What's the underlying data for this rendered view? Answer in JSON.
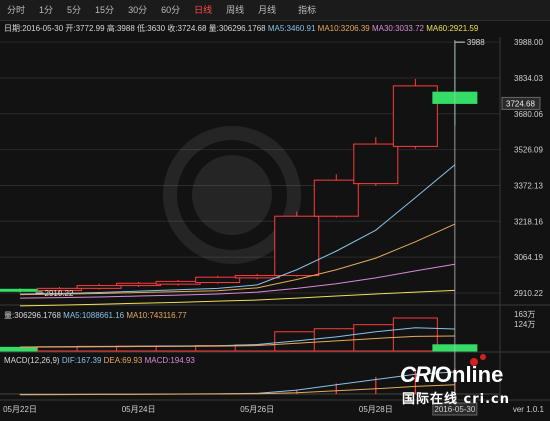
{
  "tabs": [
    "分时",
    "1分",
    "5分",
    "15分",
    "30分",
    "60分",
    "日线",
    "周线",
    "月线",
    "指标"
  ],
  "active_tab": "日线",
  "info": {
    "date": "日期:2016-05-30",
    "open": "开:3772.99",
    "high": "高:3988",
    "low": "低:3630",
    "close": "收:3724.68",
    "volume": "量:306296.1768",
    "ma5": "MA5:3460.91",
    "ma10": "MA10:3206.39",
    "ma30": "MA30:3033.72",
    "ma60": "MA60:2921.59"
  },
  "vol_info": {
    "volume": "量:306296.1768",
    "ma5": "MA5:1088661.16",
    "ma10": "MA10:743116.77"
  },
  "macd_info": {
    "name": "MACD(12,26,9)",
    "dif": "DIF:167.39",
    "dea": "DEA:69.93",
    "macd": "MACD:194.93"
  },
  "version": "ver 1.0.1",
  "logo": {
    "latin_a": "CRI",
    "latin_b": "Online",
    "chinese": "国际在线 cri.cn"
  },
  "colors": {
    "up": "#ff3c3c",
    "down": "#33dd66",
    "ma5": "#86c4ea",
    "ma10": "#e8a95a",
    "ma30": "#d88ad8",
    "ma60": "#f0e050",
    "grid": "#2a2a2a"
  },
  "chart_data": {
    "type": "candlestick",
    "price_axis": {
      "ticks": [
        2910.22,
        3064.19,
        3218.16,
        3372.13,
        3526.09,
        3680.06,
        3834.03,
        3988.0
      ],
      "range": [
        2880,
        4010
      ]
    },
    "date_ticks": [
      {
        "label": "05月22日",
        "at": 0.0
      },
      {
        "label": "05月24日",
        "at": 3.0
      },
      {
        "label": "05月26日",
        "at": 6.0
      },
      {
        "label": "05月28日",
        "at": 9.0
      },
      {
        "label": "2016-05-30",
        "at": 11.0
      }
    ],
    "candles": [
      {
        "o": 2918,
        "c": 2926,
        "h": 2930,
        "l": 2912,
        "up": false
      },
      {
        "o": 2921,
        "c": 2930,
        "h": 2936,
        "l": 2910.22,
        "up": true
      },
      {
        "o": 2930,
        "c": 2942,
        "h": 2950,
        "l": 2925,
        "up": true
      },
      {
        "o": 2942,
        "c": 2952,
        "h": 2958,
        "l": 2936,
        "up": true
      },
      {
        "o": 2948,
        "c": 2960,
        "h": 2966,
        "l": 2942,
        "up": true
      },
      {
        "o": 2955,
        "c": 2978,
        "h": 2984,
        "l": 2950,
        "up": true
      },
      {
        "o": 2975,
        "c": 2985,
        "h": 2992,
        "l": 2968,
        "up": true
      },
      {
        "o": 2985,
        "c": 3240,
        "h": 3260,
        "l": 2980,
        "up": true
      },
      {
        "o": 3240,
        "c": 3395,
        "h": 3420,
        "l": 3235,
        "up": true
      },
      {
        "o": 3380,
        "c": 3550,
        "h": 3580,
        "l": 3370,
        "up": true
      },
      {
        "o": 3540,
        "c": 3800,
        "h": 3830,
        "l": 3530,
        "up": true
      },
      {
        "o": 3772.99,
        "c": 3724.68,
        "h": 3988,
        "l": 3630,
        "up": false
      }
    ],
    "ma": {
      "ma5": [
        2905,
        2908,
        2912,
        2918,
        2924,
        2930,
        2945,
        3010,
        3090,
        3180,
        3320,
        3460.91
      ],
      "ma10": [
        2903,
        2905,
        2908,
        2912,
        2916,
        2920,
        2932,
        2968,
        3010,
        3060,
        3130,
        3206.39
      ],
      "ma30": [
        2888,
        2890,
        2893,
        2897,
        2901,
        2906,
        2914,
        2930,
        2950,
        2975,
        3005,
        3033.72
      ],
      "ma60": [
        2855,
        2858,
        2862,
        2866,
        2870,
        2875,
        2880,
        2888,
        2897,
        2906,
        2914,
        2921.59
      ]
    },
    "marks": {
      "high_label": "3988",
      "low_label": "2910.22",
      "last_price": "3724.68"
    },
    "volume": {
      "axis_ticks": [
        "163万",
        "124万"
      ],
      "values": [
        180000,
        210000,
        230000,
        240000,
        250000,
        270000,
        300000,
        950000,
        1100000,
        1300000,
        1630000,
        306296
      ],
      "max": 1630000,
      "ma5_line": [
        200000,
        210000,
        220000,
        235000,
        245000,
        260000,
        320000,
        500000,
        700000,
        950000,
        1150000,
        1088661
      ],
      "ma10_line": [
        190000,
        200000,
        210000,
        220000,
        230000,
        240000,
        270000,
        380000,
        500000,
        620000,
        720000,
        743116
      ]
    },
    "macd": {
      "hist": [
        -2,
        -1,
        0,
        1,
        2,
        3,
        5,
        35,
        80,
        130,
        180,
        194.93
      ],
      "dif": [
        -5,
        -4,
        -3,
        -2,
        0,
        2,
        5,
        30,
        70,
        110,
        150,
        167.39
      ],
      "dea": [
        -3,
        -3,
        -2,
        -2,
        -1,
        0,
        2,
        10,
        25,
        40,
        58,
        69.93
      ],
      "range": [
        -30,
        220
      ]
    }
  }
}
